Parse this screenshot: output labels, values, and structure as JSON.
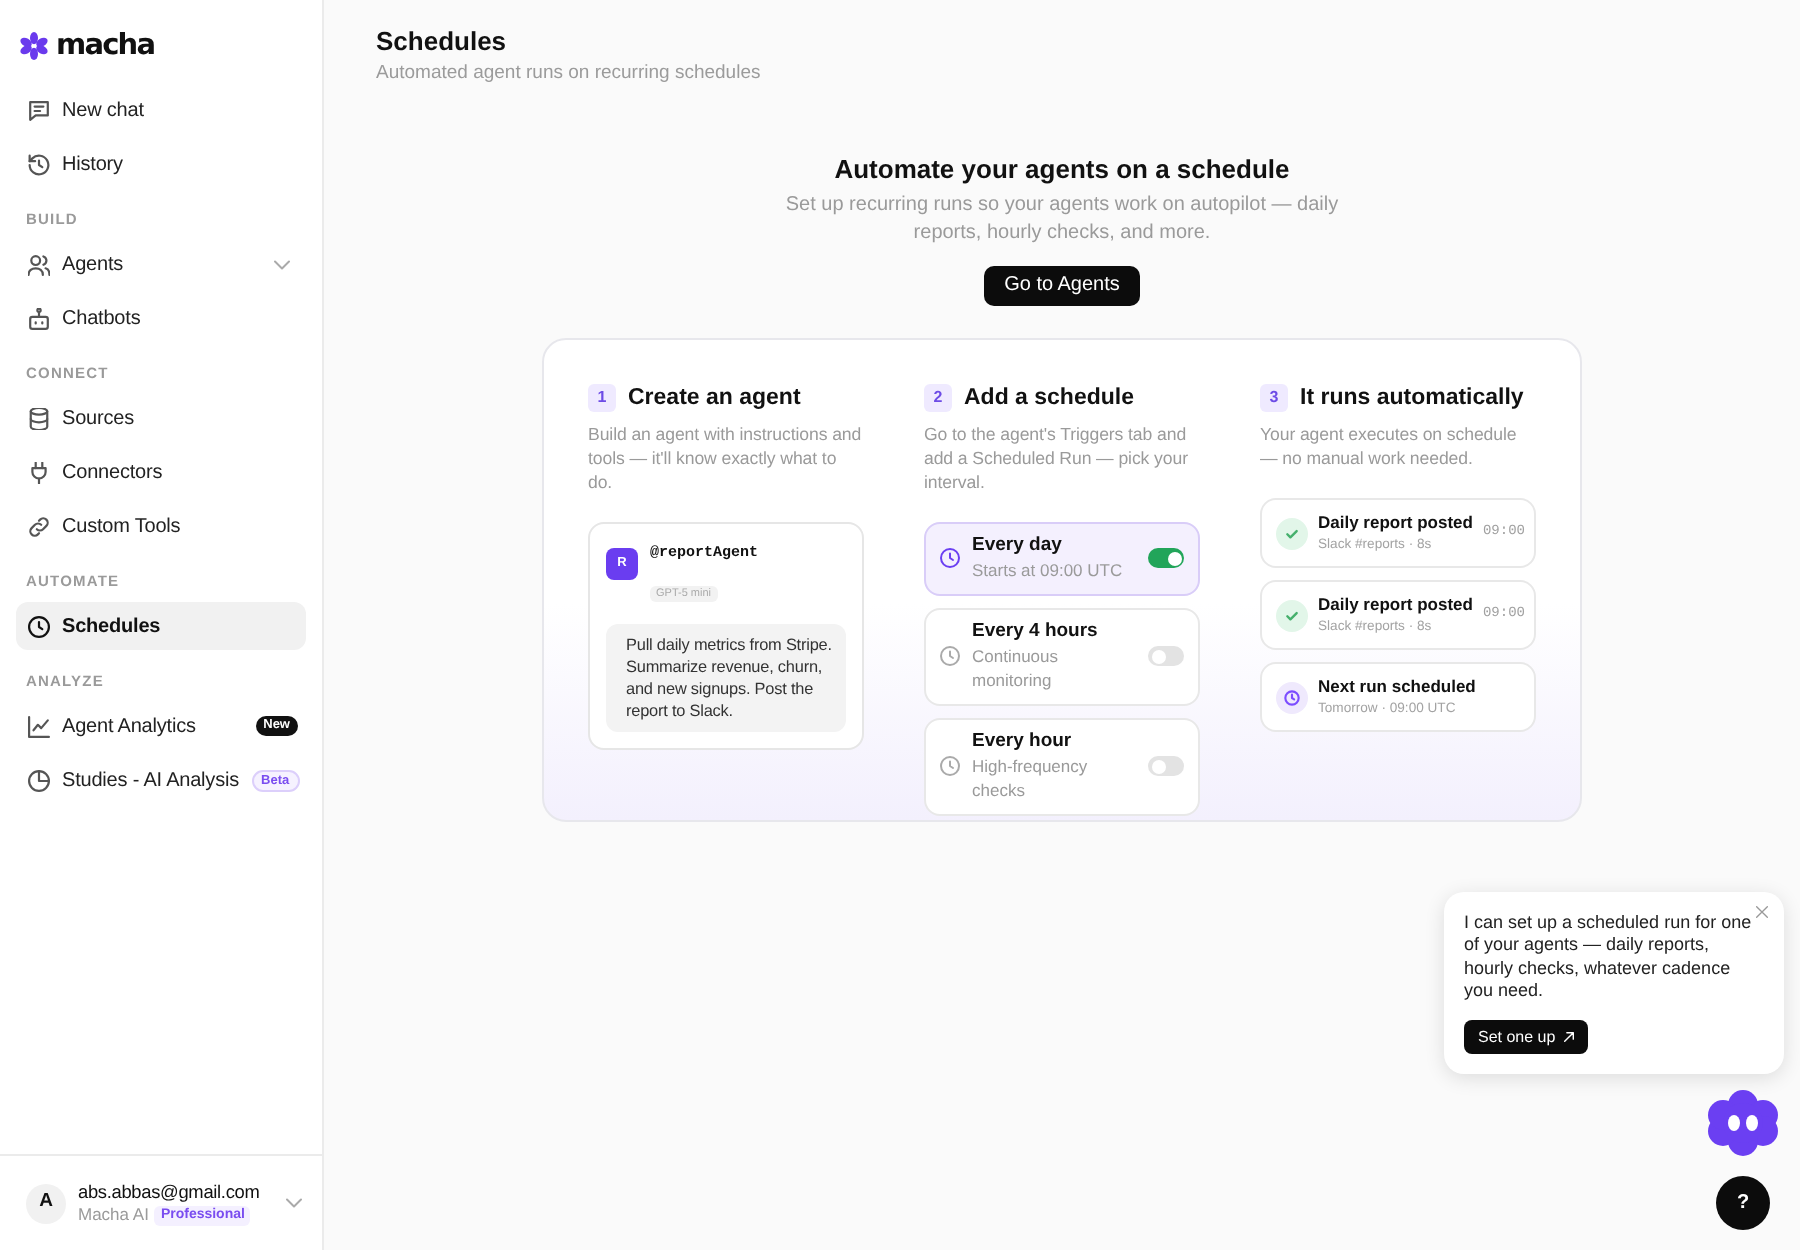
{
  "sidebar": {
    "logo": "macha",
    "groups": [
      {
        "items": [
          {
            "label": "New chat",
            "kind": "link",
            "selected": false
          },
          {
            "label": "History",
            "kind": "link",
            "selected": false
          }
        ]
      },
      {
        "heading": "BUILD",
        "items": [
          {
            "label": "Agents",
            "kind": "group",
            "selected": false
          },
          {
            "label": "Chatbots",
            "kind": "link",
            "selected": false
          }
        ]
      },
      {
        "heading": "CONNECT",
        "items": [
          {
            "label": "Sources",
            "kind": "link",
            "selected": false
          },
          {
            "label": "Connectors",
            "kind": "link",
            "selected": false
          },
          {
            "label": "Custom Tools",
            "kind": "link",
            "selected": false
          }
        ]
      },
      {
        "heading": "AUTOMATE",
        "items": [
          {
            "label": "Schedules",
            "kind": "link",
            "selected": true
          }
        ]
      },
      {
        "heading": "ANALYZE",
        "items": [
          {
            "label": "Agent Analytics",
            "kind": "link",
            "selected": false,
            "badge": {
              "text": "New",
              "kind": "dark"
            }
          },
          {
            "label": "Studies - AI Analysis",
            "kind": "link",
            "selected": false,
            "badge": {
              "text": "Beta",
              "kind": "outline"
            }
          }
        ]
      }
    ],
    "user": {
      "initial": "A",
      "email": "abs.abbas@gmail.com",
      "org": "Macha AI",
      "plan": "Professional"
    }
  },
  "header": {
    "title": "Schedules",
    "subtitle": "Automated agent runs on recurring schedules"
  },
  "hero": {
    "title": "Automate your agents on a schedule",
    "description": "Set up recurring runs so your agents work on autopilot — daily reports, hourly checks, and more.",
    "button": "Go to Agents"
  },
  "steps": [
    {
      "number": "1",
      "title": "Create an agent",
      "description": "Build an agent with instructions and tools — it'll know exactly what to do.",
      "kind": "agent",
      "agent": {
        "initial": "R",
        "handle": "@reportAgent",
        "model": "GPT-5 mini",
        "instructions": "Pull daily metrics from Stripe. Summarize revenue, churn, and new signups. Post the report to Slack."
      }
    },
    {
      "number": "2",
      "title": "Add a schedule",
      "description": "Go to the agent's Triggers tab and add a Scheduled Run — pick your interval.",
      "kind": "schedules",
      "schedules": [
        {
          "title": "Every day",
          "detail": "Starts at 09:00 UTC",
          "selected": true,
          "on": true
        },
        {
          "title": "Every 4 hours",
          "detail": "Continuous monitoring",
          "selected": false,
          "on": false
        },
        {
          "title": "Every hour",
          "detail": "High-frequency checks",
          "selected": false,
          "on": false
        }
      ]
    },
    {
      "number": "3",
      "title": "It runs automatically",
      "description": "Your agent executes on schedule — no manual work needed.",
      "kind": "events",
      "events": [
        {
          "kind": "done",
          "title": "Daily report posted",
          "detail": "Slack #reports · 8s",
          "time": "09:00"
        },
        {
          "kind": "done",
          "title": "Daily report posted",
          "detail": "Slack #reports · 8s",
          "time": "09:00"
        },
        {
          "kind": "scheduled",
          "title": "Next run scheduled",
          "detail": "Tomorrow · 09:00 UTC"
        }
      ]
    }
  ],
  "assistant": {
    "message": "I can set up a scheduled run for one of your agents — daily reports, hourly checks, whatever cadence you need.",
    "button": "Set one up"
  },
  "help_button": "?"
}
